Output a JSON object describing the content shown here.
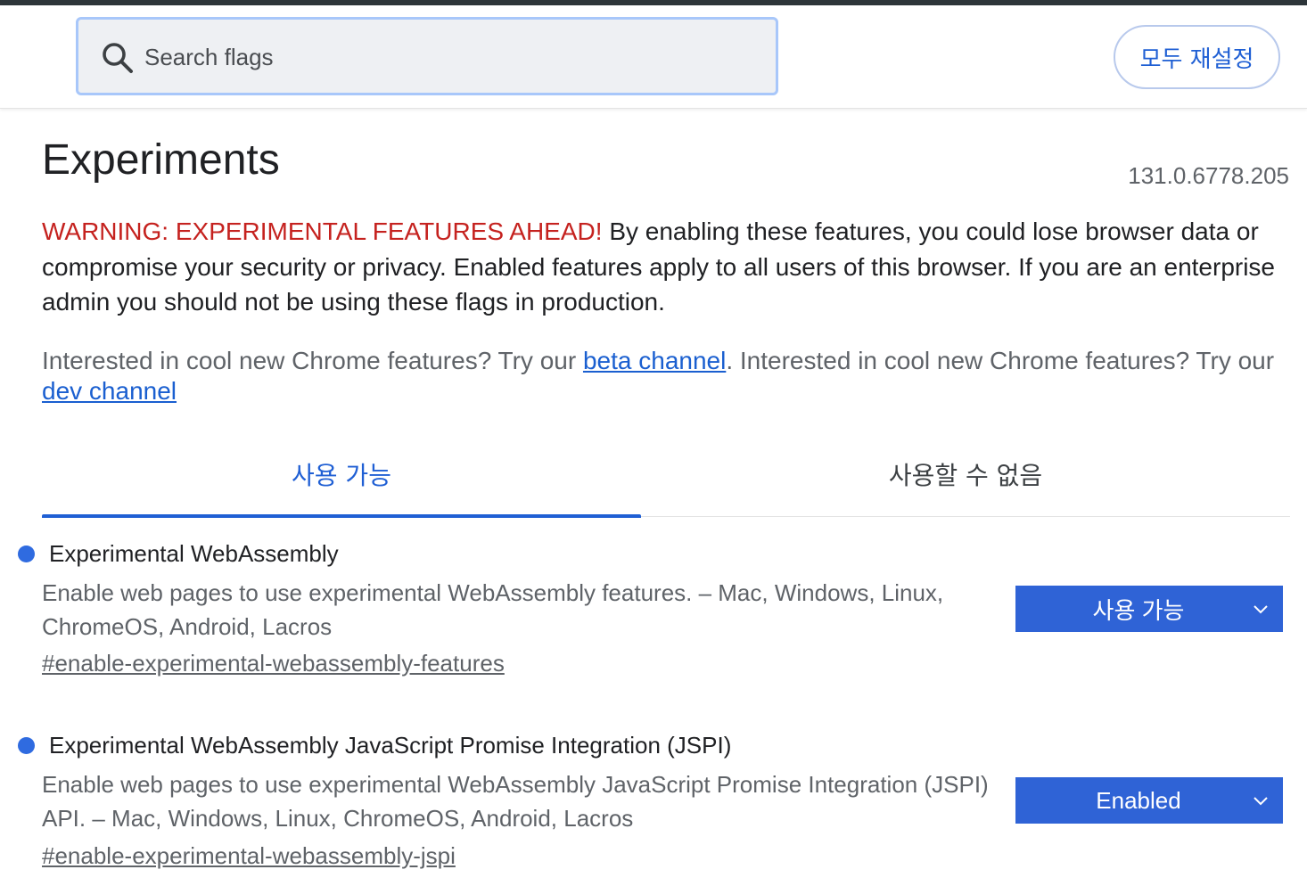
{
  "header": {
    "search_placeholder": "Search flags",
    "reset_all_label": "모두 재설정"
  },
  "page": {
    "title": "Experiments",
    "version": "131.0.6778.205",
    "warning_strong": "WARNING: EXPERIMENTAL FEATURES AHEAD!",
    "warning_text": " By enabling these features, you could lose browser data or compromise your security or privacy. Enabled features apply to all users of this browser. If you are an enterprise admin you should not be using these flags in production.",
    "channels_prefix": "Interested in cool new Chrome features? Try our ",
    "beta_link": "beta channel",
    "channels_middle": ". Interested in cool new Chrome features? Try our ",
    "dev_link": "dev channel"
  },
  "tabs": {
    "available": "사용 가능",
    "unavailable": "사용할 수 없음"
  },
  "flags": [
    {
      "title": "Experimental WebAssembly",
      "description": "Enable web pages to use experimental WebAssembly features. – Mac, Windows, Linux, ChromeOS, Android, Lacros",
      "link": "#enable-experimental-webassembly-features",
      "value": "사용 가능"
    },
    {
      "title": "Experimental WebAssembly JavaScript Promise Integration (JSPI)",
      "description": "Enable web pages to use experimental WebAssembly JavaScript Promise Integration (JSPI) API. – Mac, Windows, Linux, ChromeOS, Android, Lacros",
      "link": "#enable-experimental-webassembly-jspi",
      "value": "Enabled"
    }
  ],
  "colors": {
    "accent": "#1f5fd4",
    "warning": "#c5221f",
    "select_bg": "#2f63d6"
  }
}
